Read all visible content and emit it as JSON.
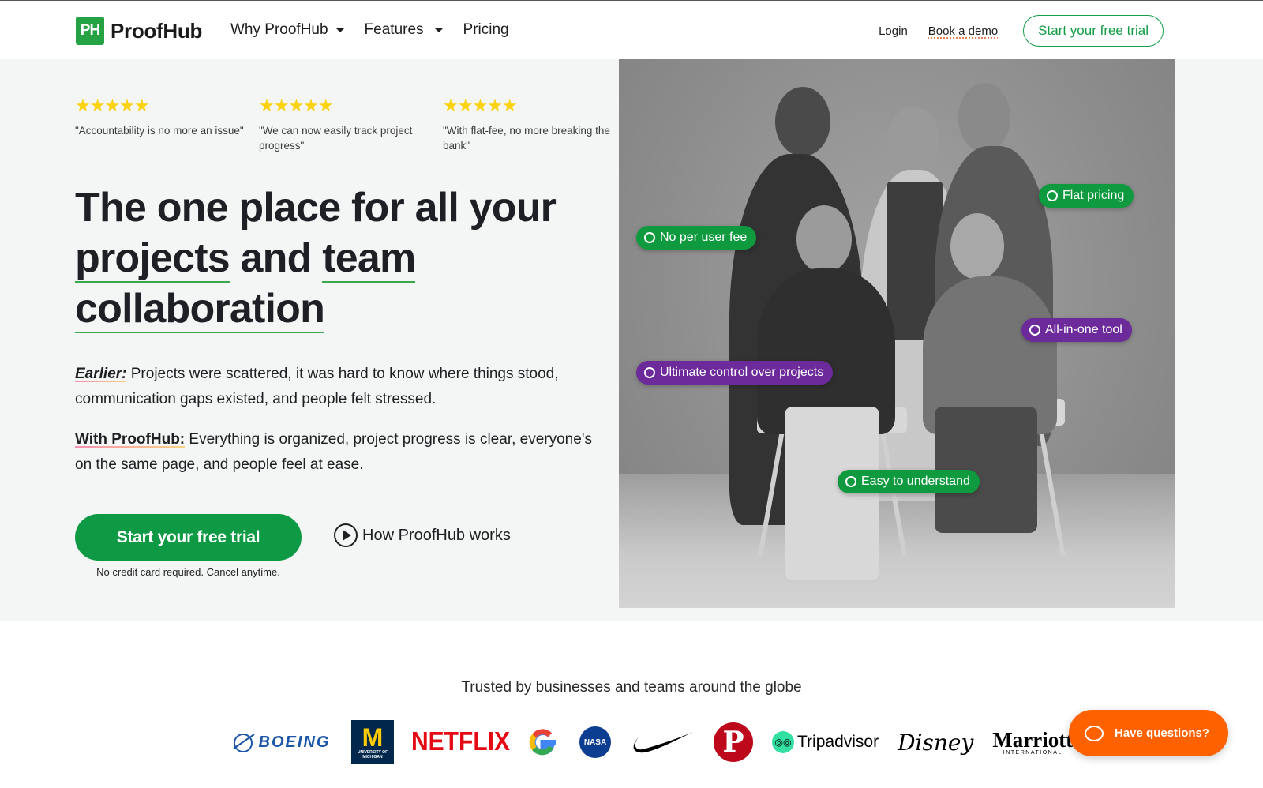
{
  "header": {
    "logo_mark": "PH",
    "logo_text": "ProofHub",
    "nav": [
      {
        "label": "Why ProofHub",
        "has_dropdown": true
      },
      {
        "label": "Features",
        "has_dropdown": true
      },
      {
        "label": "Pricing",
        "has_dropdown": false
      }
    ],
    "login_label": "Login",
    "book_demo_label": "Book a demo",
    "cta_label": "Start your free trial"
  },
  "hero": {
    "reviews": [
      {
        "rating": 5,
        "stars": "★★★★★",
        "quote": "\"Accountability is no more an issue\""
      },
      {
        "rating": 5,
        "stars": "★★★★★",
        "quote": "\"We can now easily track project progress\""
      },
      {
        "rating": 5,
        "stars": "★★★★★",
        "quote": "\"With flat-fee, no more breaking the bank\""
      }
    ],
    "headline": {
      "part1": "The one place for all your ",
      "underlined1": "projects",
      "part2": " and ",
      "underlined2": "team",
      "part3": " ",
      "underlined3": "collaboration"
    },
    "earlier_label": "Earlier:",
    "earlier_text": " Projects were scattered, it was hard to know where things stood, communication gaps existed, and people felt stressed.",
    "with_label": "With ProofHub:",
    "with_text": " Everything is organized, project progress is clear, everyone's on the same page, and people feel at ease.",
    "cta_label": "Start your free trial",
    "cta_note": "No credit card required. Cancel anytime.",
    "video_link_label": "How ProofHub works"
  },
  "photo_badges": [
    {
      "label": "Flat pricing",
      "color": "green"
    },
    {
      "label": "No per user fee",
      "color": "green"
    },
    {
      "label": "All-in-one tool",
      "color": "purple"
    },
    {
      "label": "Ultimate control over projects",
      "color": "purple"
    },
    {
      "label": "Easy to understand",
      "color": "green"
    }
  ],
  "trusted": {
    "title": "Trusted by businesses and teams around the globe",
    "logos": [
      {
        "name": "Boeing",
        "text": "BOEING"
      },
      {
        "name": "University of Michigan",
        "text": "M",
        "subtext": "UNIVERSITY OF MICHIGAN"
      },
      {
        "name": "Netflix",
        "text": "NETFLIX"
      },
      {
        "name": "Google",
        "text": "G"
      },
      {
        "name": "NASA",
        "text": "NASA"
      },
      {
        "name": "Nike",
        "text": ""
      },
      {
        "name": "Pinterest",
        "text": "P"
      },
      {
        "name": "Tripadvisor",
        "text": "Tripadvisor"
      },
      {
        "name": "Disney",
        "text": "Disney"
      },
      {
        "name": "Marriott",
        "text": "Marriott",
        "subtext": "INTERNATIONAL"
      }
    ]
  },
  "chat_widget": {
    "label": "Have questions?"
  },
  "colors": {
    "brand_green": "#0e9a44",
    "badge_purple": "#6c2a9a",
    "star_yellow": "#fbd20e",
    "chat_orange": "#fe6200",
    "hero_bg": "#f4f5f5"
  }
}
